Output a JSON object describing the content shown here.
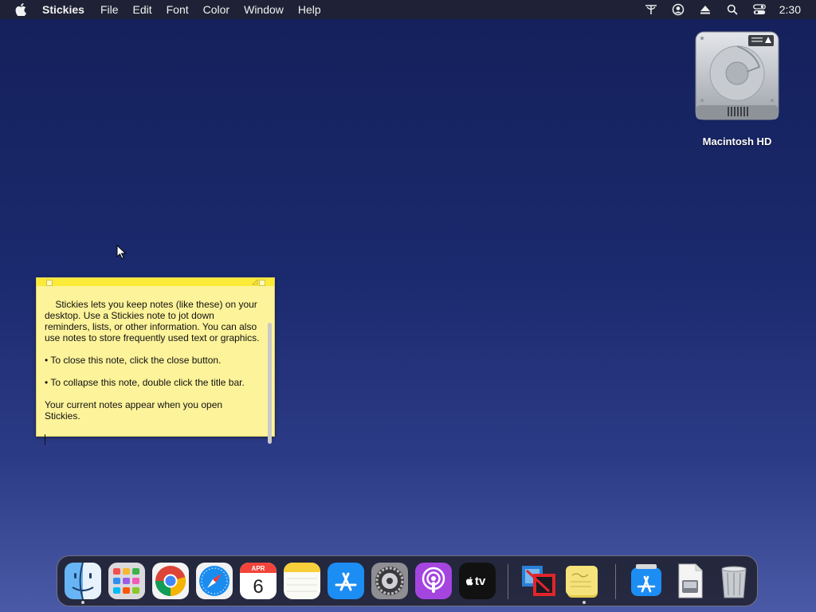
{
  "menubar": {
    "app_name": "Stickies",
    "menus": [
      "File",
      "Edit",
      "Font",
      "Color",
      "Window",
      "Help"
    ],
    "clock": "2:30",
    "status_icons": [
      "wifi-icon",
      "user-icon",
      "eject-icon",
      "search-icon",
      "control-center-icon"
    ]
  },
  "desktop": {
    "disk_label": "Macintosh HD"
  },
  "sticky": {
    "text": "Stickies lets you keep notes (like these) on your desktop. Use a Stickies note to jot down reminders, lists, or other information. You can also use notes to store frequently used text or graphics.\n\n• To close this note, click the close button.\n\n• To collapse this note, double click the title bar.\n\nYour current notes appear when you open Stickies.",
    "color": "#fdf39a"
  },
  "dock": {
    "apps": [
      {
        "name": "Finder",
        "running": true
      },
      {
        "name": "Launchpad",
        "running": false
      },
      {
        "name": "Google Chrome",
        "running": false
      },
      {
        "name": "Safari",
        "running": false
      },
      {
        "name": "Calendar",
        "running": false,
        "month": "APR",
        "day": "6"
      },
      {
        "name": "Notes",
        "running": false
      },
      {
        "name": "App Store",
        "running": false
      },
      {
        "name": "System Preferences",
        "running": false
      },
      {
        "name": "Podcasts",
        "running": false
      },
      {
        "name": "TV",
        "running": false,
        "text": "tv"
      },
      {
        "name": "Parallels",
        "running": false
      },
      {
        "name": "Stickies",
        "running": true
      },
      {
        "name": "App Store Downloads",
        "running": false
      },
      {
        "name": "Documents",
        "running": false
      },
      {
        "name": "Trash",
        "running": false
      }
    ]
  }
}
